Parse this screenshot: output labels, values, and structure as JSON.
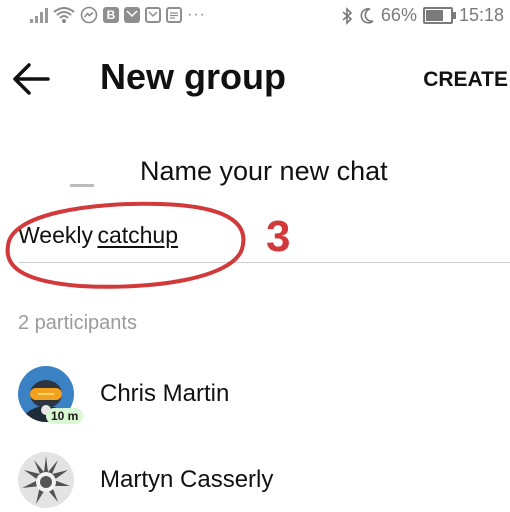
{
  "status_bar": {
    "battery": "66%",
    "time": "15:18",
    "notification_letter": "B",
    "overflow": "···",
    "battery_level": 0.66
  },
  "header": {
    "title": "New group",
    "create_label": "CREATE"
  },
  "form": {
    "prompt": "Name your new chat",
    "group_name_word1": "Weekly",
    "group_name_word2": "catchup",
    "annotation_number": "3"
  },
  "participants": {
    "count_label": "2 participants",
    "items": [
      {
        "name": "Chris Martin",
        "badge": "10 m"
      },
      {
        "name": "Martyn Casserly"
      }
    ]
  },
  "colors": {
    "annotation": "#d2393a",
    "badge_bg": "#d9f7d3"
  }
}
